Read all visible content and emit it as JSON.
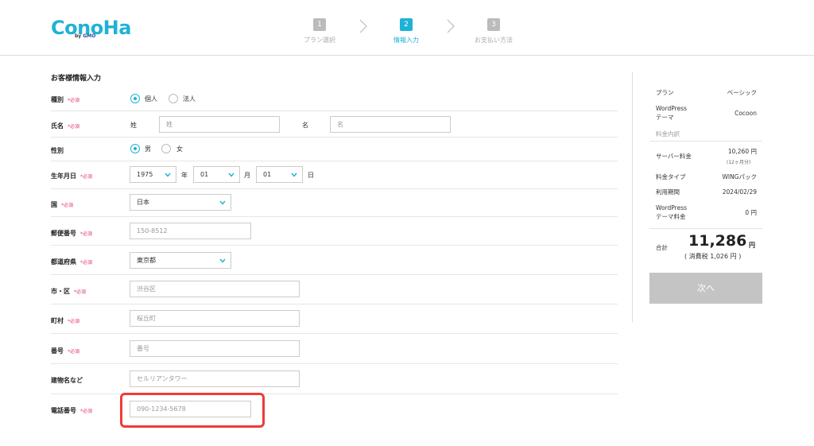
{
  "header": {
    "logo_text": "ConoHa",
    "logo_sub_by": "by",
    "logo_sub_brand": "GMO",
    "steps": [
      {
        "num": "1",
        "label": "プラン選択"
      },
      {
        "num": "2",
        "label": "情報入力"
      },
      {
        "num": "3",
        "label": "お支払い方法"
      }
    ]
  },
  "form": {
    "title": "お客様情報入力",
    "required_mark": "*必須",
    "type": {
      "label": "種別",
      "options": [
        "個人",
        "法人"
      ],
      "selected": "個人"
    },
    "name": {
      "label": "氏名",
      "last_label": "姓",
      "first_label": "名",
      "last_placeholder": "姓",
      "first_placeholder": "名"
    },
    "gender": {
      "label": "性別",
      "options": [
        "男",
        "女"
      ],
      "selected": "男"
    },
    "birthday": {
      "label": "生年月日",
      "year": "1975",
      "year_unit": "年",
      "month": "01",
      "month_unit": "月",
      "day": "01",
      "day_unit": "日"
    },
    "country": {
      "label": "国",
      "value": "日本"
    },
    "postal": {
      "label": "郵便番号",
      "placeholder": "150-8512"
    },
    "prefecture": {
      "label": "都道府県",
      "value": "東京都"
    },
    "city": {
      "label": "市・区",
      "placeholder": "渋谷区"
    },
    "town": {
      "label": "町村",
      "placeholder": "桜丘町"
    },
    "number": {
      "label": "番号",
      "placeholder": "番号"
    },
    "building": {
      "label": "建物名など",
      "placeholder": "セルリアンタワー"
    },
    "phone": {
      "label": "電話番号",
      "placeholder": "090-1234-5678"
    }
  },
  "summary": {
    "plan_label": "プラン",
    "plan_value": "ベーシック",
    "theme_label_1": "WordPress",
    "theme_label_2": "テーマ",
    "theme_value": "Cocoon",
    "breakdown_label": "料金内訳",
    "server_fee_label": "サーバー料金",
    "server_fee_value": "10,260 円",
    "server_fee_note": "(12ヶ月分)",
    "fee_type_label": "料金タイプ",
    "fee_type_value": "WINGパック",
    "period_label": "利用期間",
    "period_value": "2024/02/29",
    "theme_fee_label_1": "WordPress",
    "theme_fee_label_2": "テーマ料金",
    "theme_fee_value": "0 円",
    "total_label": "合計",
    "total_value": "11,286",
    "total_unit": "円",
    "tax_text": "( 消費税 1,026 円 )",
    "next_button": "次へ"
  },
  "colors": {
    "accent": "#1fb2d6",
    "required": "#e03a6e",
    "highlight": "#ee3b3b",
    "button": "#c4c4c4"
  }
}
